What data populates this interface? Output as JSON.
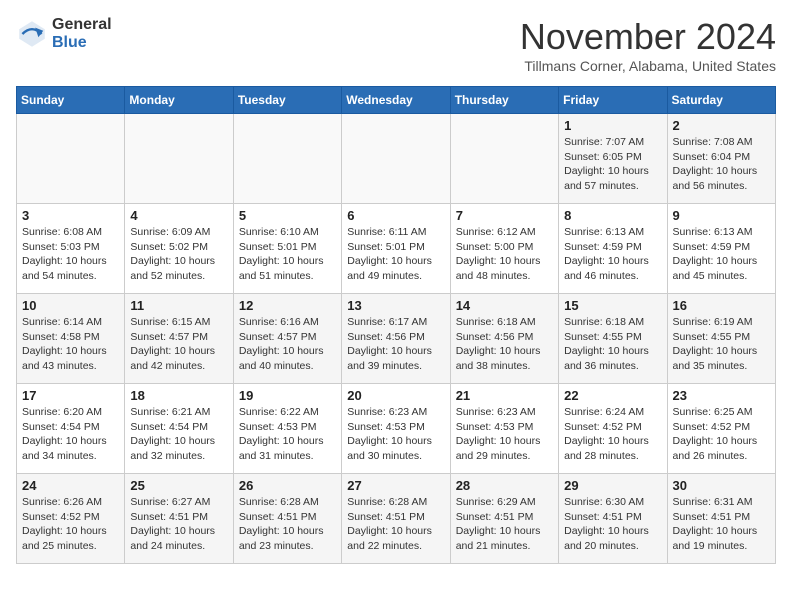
{
  "logo": {
    "general": "General",
    "blue": "Blue"
  },
  "header": {
    "title": "November 2024",
    "location": "Tillmans Corner, Alabama, United States"
  },
  "weekdays": [
    "Sunday",
    "Monday",
    "Tuesday",
    "Wednesday",
    "Thursday",
    "Friday",
    "Saturday"
  ],
  "weeks": [
    [
      {
        "day": "",
        "info": ""
      },
      {
        "day": "",
        "info": ""
      },
      {
        "day": "",
        "info": ""
      },
      {
        "day": "",
        "info": ""
      },
      {
        "day": "",
        "info": ""
      },
      {
        "day": "1",
        "info": "Sunrise: 7:07 AM\nSunset: 6:05 PM\nDaylight: 10 hours\nand 57 minutes."
      },
      {
        "day": "2",
        "info": "Sunrise: 7:08 AM\nSunset: 6:04 PM\nDaylight: 10 hours\nand 56 minutes."
      }
    ],
    [
      {
        "day": "3",
        "info": "Sunrise: 6:08 AM\nSunset: 5:03 PM\nDaylight: 10 hours\nand 54 minutes."
      },
      {
        "day": "4",
        "info": "Sunrise: 6:09 AM\nSunset: 5:02 PM\nDaylight: 10 hours\nand 52 minutes."
      },
      {
        "day": "5",
        "info": "Sunrise: 6:10 AM\nSunset: 5:01 PM\nDaylight: 10 hours\nand 51 minutes."
      },
      {
        "day": "6",
        "info": "Sunrise: 6:11 AM\nSunset: 5:01 PM\nDaylight: 10 hours\nand 49 minutes."
      },
      {
        "day": "7",
        "info": "Sunrise: 6:12 AM\nSunset: 5:00 PM\nDaylight: 10 hours\nand 48 minutes."
      },
      {
        "day": "8",
        "info": "Sunrise: 6:13 AM\nSunset: 4:59 PM\nDaylight: 10 hours\nand 46 minutes."
      },
      {
        "day": "9",
        "info": "Sunrise: 6:13 AM\nSunset: 4:59 PM\nDaylight: 10 hours\nand 45 minutes."
      }
    ],
    [
      {
        "day": "10",
        "info": "Sunrise: 6:14 AM\nSunset: 4:58 PM\nDaylight: 10 hours\nand 43 minutes."
      },
      {
        "day": "11",
        "info": "Sunrise: 6:15 AM\nSunset: 4:57 PM\nDaylight: 10 hours\nand 42 minutes."
      },
      {
        "day": "12",
        "info": "Sunrise: 6:16 AM\nSunset: 4:57 PM\nDaylight: 10 hours\nand 40 minutes."
      },
      {
        "day": "13",
        "info": "Sunrise: 6:17 AM\nSunset: 4:56 PM\nDaylight: 10 hours\nand 39 minutes."
      },
      {
        "day": "14",
        "info": "Sunrise: 6:18 AM\nSunset: 4:56 PM\nDaylight: 10 hours\nand 38 minutes."
      },
      {
        "day": "15",
        "info": "Sunrise: 6:18 AM\nSunset: 4:55 PM\nDaylight: 10 hours\nand 36 minutes."
      },
      {
        "day": "16",
        "info": "Sunrise: 6:19 AM\nSunset: 4:55 PM\nDaylight: 10 hours\nand 35 minutes."
      }
    ],
    [
      {
        "day": "17",
        "info": "Sunrise: 6:20 AM\nSunset: 4:54 PM\nDaylight: 10 hours\nand 34 minutes."
      },
      {
        "day": "18",
        "info": "Sunrise: 6:21 AM\nSunset: 4:54 PM\nDaylight: 10 hours\nand 32 minutes."
      },
      {
        "day": "19",
        "info": "Sunrise: 6:22 AM\nSunset: 4:53 PM\nDaylight: 10 hours\nand 31 minutes."
      },
      {
        "day": "20",
        "info": "Sunrise: 6:23 AM\nSunset: 4:53 PM\nDaylight: 10 hours\nand 30 minutes."
      },
      {
        "day": "21",
        "info": "Sunrise: 6:23 AM\nSunset: 4:53 PM\nDaylight: 10 hours\nand 29 minutes."
      },
      {
        "day": "22",
        "info": "Sunrise: 6:24 AM\nSunset: 4:52 PM\nDaylight: 10 hours\nand 28 minutes."
      },
      {
        "day": "23",
        "info": "Sunrise: 6:25 AM\nSunset: 4:52 PM\nDaylight: 10 hours\nand 26 minutes."
      }
    ],
    [
      {
        "day": "24",
        "info": "Sunrise: 6:26 AM\nSunset: 4:52 PM\nDaylight: 10 hours\nand 25 minutes."
      },
      {
        "day": "25",
        "info": "Sunrise: 6:27 AM\nSunset: 4:51 PM\nDaylight: 10 hours\nand 24 minutes."
      },
      {
        "day": "26",
        "info": "Sunrise: 6:28 AM\nSunset: 4:51 PM\nDaylight: 10 hours\nand 23 minutes."
      },
      {
        "day": "27",
        "info": "Sunrise: 6:28 AM\nSunset: 4:51 PM\nDaylight: 10 hours\nand 22 minutes."
      },
      {
        "day": "28",
        "info": "Sunrise: 6:29 AM\nSunset: 4:51 PM\nDaylight: 10 hours\nand 21 minutes."
      },
      {
        "day": "29",
        "info": "Sunrise: 6:30 AM\nSunset: 4:51 PM\nDaylight: 10 hours\nand 20 minutes."
      },
      {
        "day": "30",
        "info": "Sunrise: 6:31 AM\nSunset: 4:51 PM\nDaylight: 10 hours\nand 19 minutes."
      }
    ]
  ]
}
